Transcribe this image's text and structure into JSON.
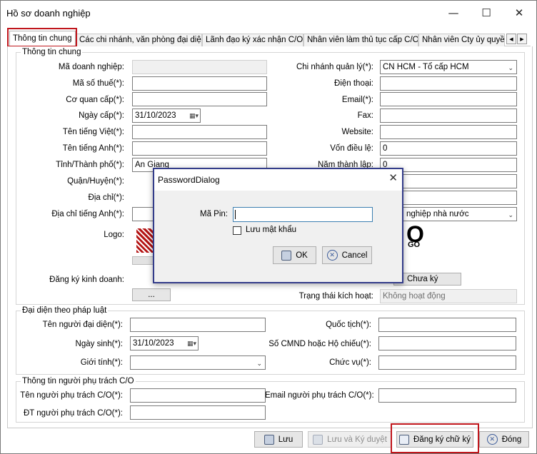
{
  "window": {
    "title": "Hồ sơ doanh nghiệp",
    "minimize": "—",
    "maximize": "☐",
    "close": "✕"
  },
  "tabs": [
    "Thông tin chung",
    "Các chi nhánh, văn phòng đại diện",
    "Lãnh đạo ký xác nhận C/O",
    "Nhân viên làm thủ tục cấp C/O",
    "Nhân viên Cty ủy quyền"
  ],
  "tab_scroll": {
    "left": "◀",
    "right": "▶"
  },
  "general": {
    "title": "Thông tin chung",
    "ma_dn": {
      "label": "Mã doanh nghiệp:",
      "value": ""
    },
    "ma_so_thue": {
      "label": "Mã số thuế(*):",
      "value": ""
    },
    "co_quan_cap": {
      "label": "Cơ quan cấp(*):",
      "value": ""
    },
    "ngay_cap": {
      "label": "Ngày cấp(*):",
      "value": "31/10/2023"
    },
    "ten_tieng_viet": {
      "label": "Tên tiếng Việt(*):",
      "value": ""
    },
    "ten_tieng_anh": {
      "label": "Tên tiếng Anh(*):",
      "value": ""
    },
    "tinh": {
      "label": "Tỉnh/Thành phố(*):",
      "value": "An Giang"
    },
    "quan": {
      "label": "Quận/Huyện(*):",
      "value": ""
    },
    "dia_chi": {
      "label": "Địa chỉ(*):",
      "value": ""
    },
    "dia_chi_ta": {
      "label": "Địa chỉ tiếng Anh(*):",
      "value": ""
    },
    "logo": {
      "label": "Logo:",
      "text": "O",
      "text2": "GO"
    },
    "dkkd": {
      "label": "Đăng ký kinh doanh:",
      "button": "..."
    },
    "chi_nhanh": {
      "label": "Chi nhánh quản lý(*):",
      "value": "CN HCM - Tổ cấp HCM"
    },
    "dien_thoai": {
      "label": "Điện thoại:",
      "value": ""
    },
    "email": {
      "label": "Email(*):",
      "value": ""
    },
    "fax": {
      "label": "Fax:",
      "value": ""
    },
    "website": {
      "label": "Website:",
      "value": ""
    },
    "von": {
      "label": "Vốn điều lệ:",
      "value": "0"
    },
    "nam_thanh_lap": {
      "label": "Năm thành lập:",
      "value": "0"
    },
    "loai_hinh": {
      "value": "nghiệp nhà nước"
    },
    "chu_ky": {
      "button": "Chưa ký"
    },
    "trang_thai": {
      "label": "Trạng thái kích hoạt:",
      "value": "Không hoạt động"
    }
  },
  "legal": {
    "title": "Đại diện theo pháp luật",
    "ten": {
      "label": "Tên người đại diện(*):",
      "value": ""
    },
    "ngay_sinh": {
      "label": "Ngày sinh(*):",
      "value": "31/10/2023"
    },
    "gioi_tinh": {
      "label": "Giới tính(*):",
      "value": ""
    },
    "quoc_tich": {
      "label": "Quốc tịch(*):",
      "value": ""
    },
    "cmnd": {
      "label": "Số CMND hoặc Hộ chiếu(*):",
      "value": ""
    },
    "chuc_vu": {
      "label": "Chức vụ(*):",
      "value": ""
    }
  },
  "co_person": {
    "title": "Thông tin người phụ trách C/O",
    "ten": {
      "label": "Tên người phụ trách C/O(*):",
      "value": ""
    },
    "dt": {
      "label": "ĐT người phụ trách C/O(*):",
      "value": ""
    },
    "email": {
      "label": "Email người phụ trách C/O(*):",
      "value": ""
    }
  },
  "footer": {
    "luu": "Lưu",
    "luu_ky": "Lưu và Ký duyệt",
    "dang_ky": "Đăng ký chữ ký",
    "dong": "Đóng"
  },
  "dialog": {
    "title": "PasswordDialog",
    "close": "✕",
    "pin_label": "Mã Pin:",
    "pin_value": "",
    "remember": "Lưu mật khẩu",
    "ok": "OK",
    "cancel": "Cancel"
  }
}
